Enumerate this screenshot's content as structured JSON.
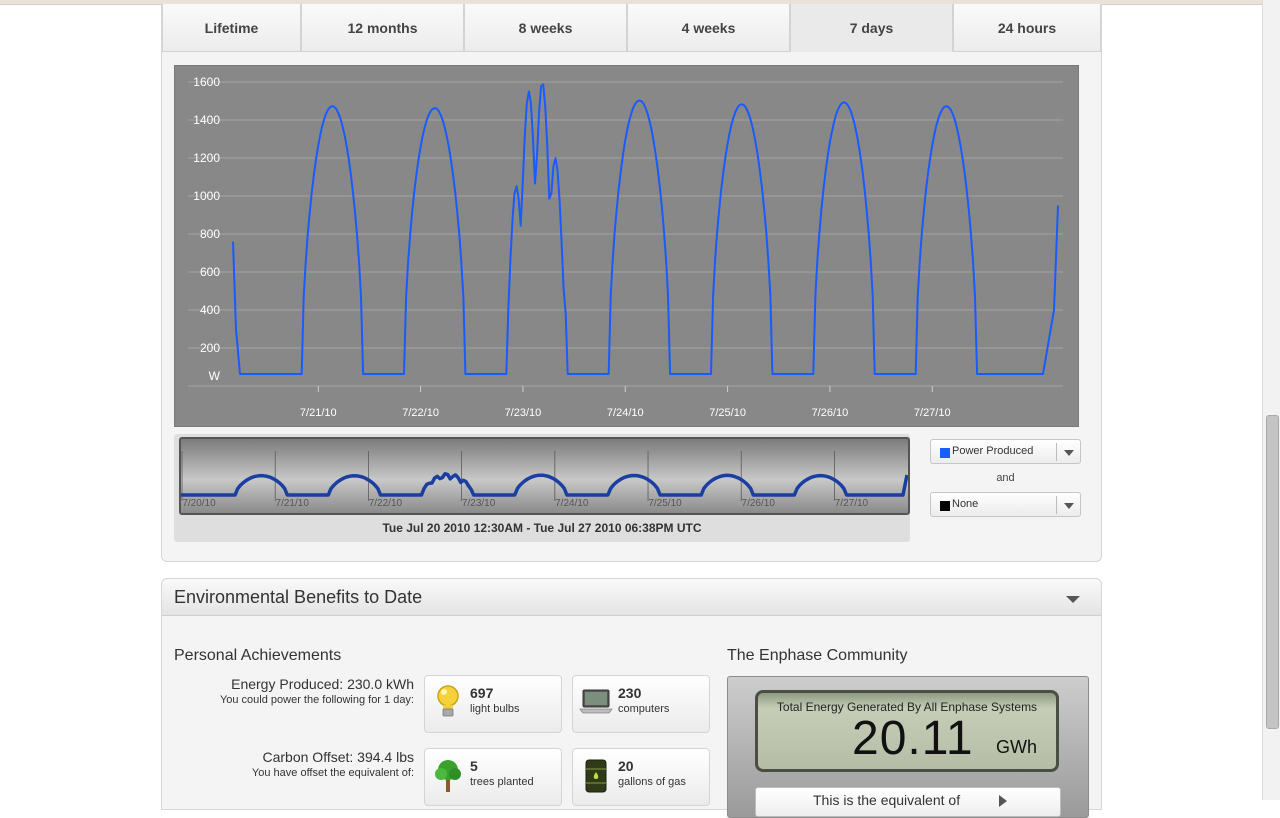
{
  "tabs": [
    {
      "label": "Lifetime",
      "active": false
    },
    {
      "label": "12 months",
      "active": false
    },
    {
      "label": "8 weeks",
      "active": false
    },
    {
      "label": "4 weeks",
      "active": false
    },
    {
      "label": "7 days",
      "active": true
    },
    {
      "label": "24 hours",
      "active": false
    }
  ],
  "chart_data": {
    "type": "line",
    "series": [
      {
        "name": "Power Produced",
        "color": "#1a5bff"
      }
    ],
    "ylim": [
      0,
      1600
    ],
    "yticks": [
      "1600",
      "1400",
      "1200",
      "1000",
      "800",
      "600",
      "400",
      "200"
    ],
    "y_unit": "W",
    "xticks": [
      "7/21/10",
      "7/22/10",
      "7/23/10",
      "7/24/10",
      "7/25/10",
      "7/26/10",
      "7/27/10"
    ],
    "days": [
      {
        "start": 0,
        "peak": 1410,
        "noisy": false
      },
      {
        "start": 1,
        "peak": 1400,
        "noisy": false
      },
      {
        "start": 2,
        "peak": 1570,
        "noisy": true
      },
      {
        "start": 3,
        "peak": 1440,
        "noisy": false
      },
      {
        "start": 4,
        "peak": 1420,
        "noisy": false
      },
      {
        "start": 5,
        "peak": 1430,
        "noisy": false
      },
      {
        "start": 6,
        "peak": 1410,
        "noisy": false
      }
    ],
    "range_start_value": 760,
    "range_end_value": 950,
    "grid": true
  },
  "navigator": {
    "ticks": [
      "7/20/10",
      "7/21/10",
      "7/22/10",
      "7/23/10",
      "7/24/10",
      "7/25/10",
      "7/26/10",
      "7/27/10"
    ],
    "range_label": "Tue Jul 20 2010 12:30AM - Tue Jul 27 2010 06:38PM UTC"
  },
  "series_select": {
    "primary": {
      "label": "Power Produced",
      "color": "#1a5bff"
    },
    "and_label": "and",
    "secondary": {
      "label": "None",
      "color": "#000000"
    }
  },
  "env": {
    "title": "Environmental Benefits to Date",
    "personal_title": "Personal Achievements",
    "energy_label": "Energy Produced: 230.0 kWh",
    "energy_sub": "You could power the following for 1 day:",
    "carbon_label": "Carbon Offset: 394.4 lbs",
    "carbon_sub": "You have offset the equivalent of:",
    "stats": [
      {
        "value": "697",
        "unit": "light bulbs",
        "icon": "light-bulb-icon"
      },
      {
        "value": "230",
        "unit": "computers",
        "icon": "laptop-icon"
      },
      {
        "value": "5",
        "unit": "trees planted",
        "icon": "tree-icon"
      },
      {
        "value": "20",
        "unit": "gallons of gas",
        "icon": "gas-barrel-icon"
      }
    ]
  },
  "community": {
    "title": "The Enphase Community",
    "caption": "Total Energy Generated By All Enphase Systems",
    "value": "20.11",
    "unit": "GWh",
    "equivalent_label": "This is the equivalent of"
  }
}
